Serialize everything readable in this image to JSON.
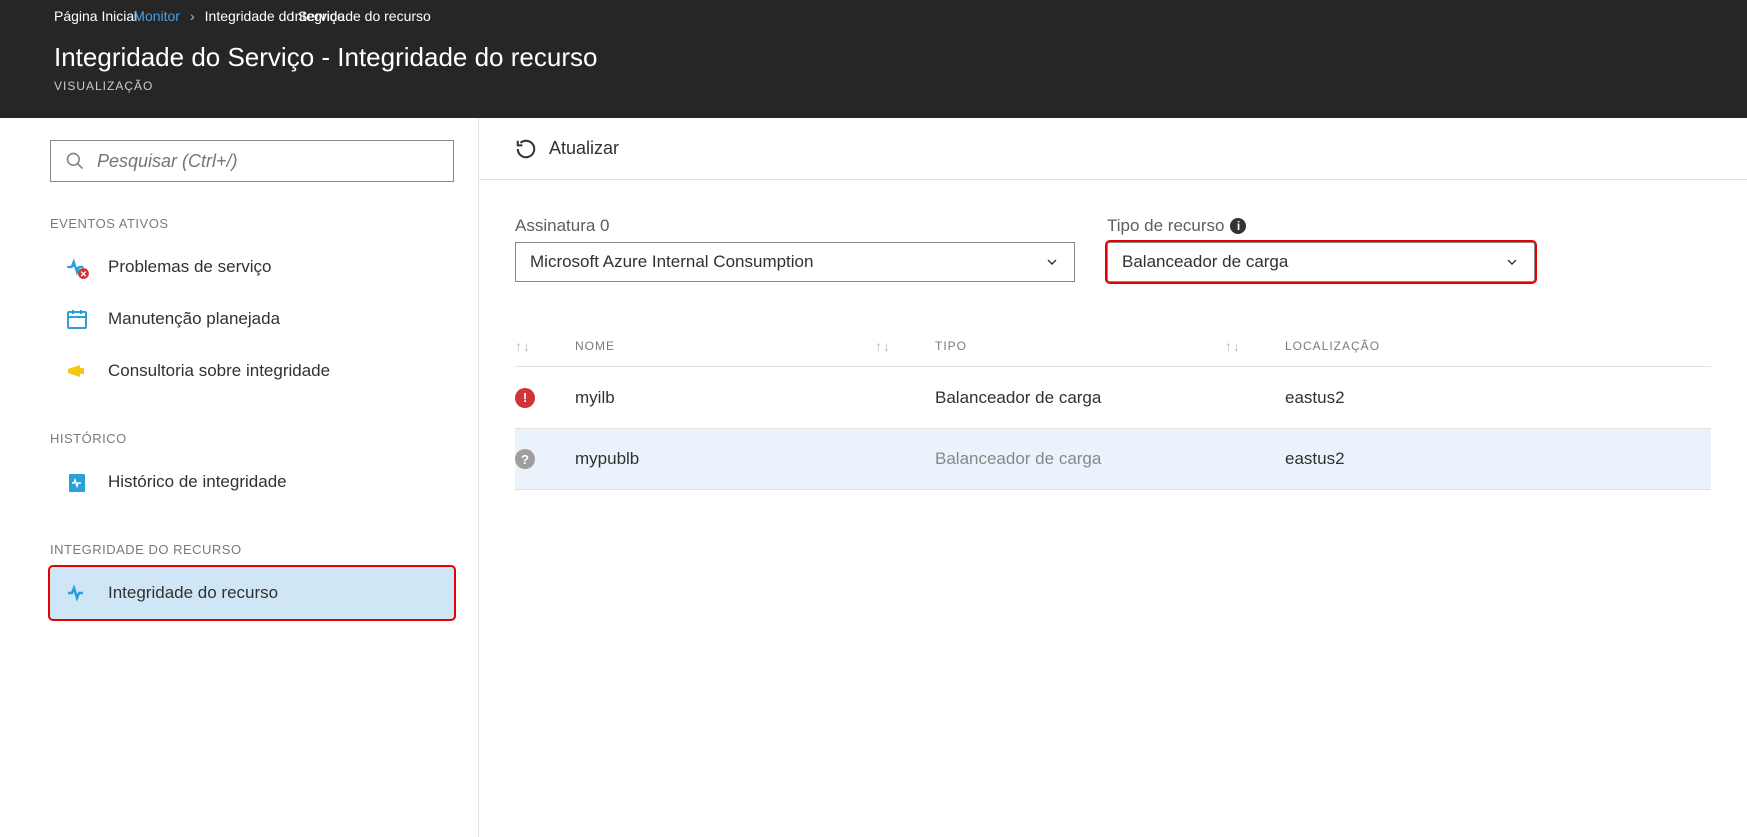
{
  "breadcrumb": {
    "home": "Página Inicial",
    "monitor": "Monitor",
    "service_health": "Integridade do Serviço",
    "resource_health": "Integridade do recurso"
  },
  "header": {
    "title": "Integridade do Serviço - Integridade do recurso",
    "subtitle": "VISUALIZAÇÃO"
  },
  "search": {
    "placeholder": "Pesquisar (Ctrl+/)"
  },
  "sidebar": {
    "sections": {
      "active_events": "EVENTOS ATIVOS",
      "history": "HISTÓRICO",
      "resource_health": "INTEGRIDADE DO RECURSO"
    },
    "items": {
      "service_issues": "Problemas de serviço",
      "planned_maintenance": "Manutenção planejada",
      "health_advisories": "Consultoria sobre integridade",
      "health_history": "Histórico de integridade",
      "resource_health": "Integridade do recurso"
    }
  },
  "toolbar": {
    "refresh": "Atualizar"
  },
  "filters": {
    "subscription_label": "Assinatura 0",
    "subscription_value": "Microsoft Azure Internal Consumption",
    "resource_type_label": "Tipo de recurso",
    "resource_type_value": "Balanceador de carga"
  },
  "table": {
    "columns": {
      "name": "NOME",
      "type": "TIPO",
      "location": "LOCALIZAÇÃO"
    },
    "rows": [
      {
        "status": "error",
        "name": "myilb",
        "type": "Balanceador de carga",
        "location": "eastus2"
      },
      {
        "status": "unknown",
        "name": "mypublb",
        "type": "Balanceador de carga",
        "location": "eastus2"
      }
    ]
  }
}
